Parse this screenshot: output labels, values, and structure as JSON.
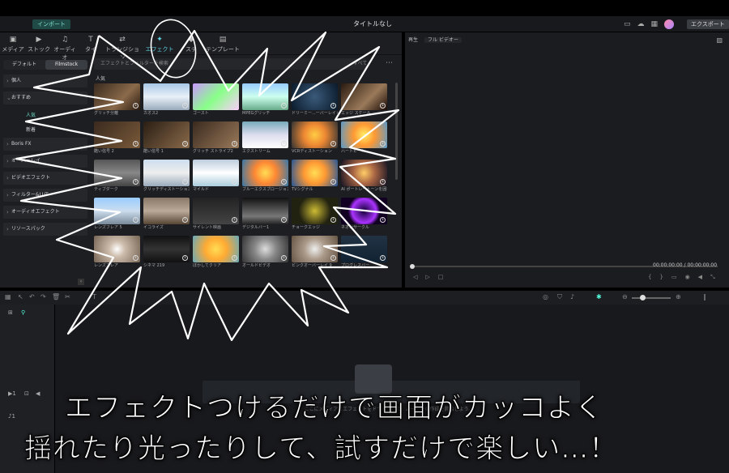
{
  "titlebar": {
    "import_label": "インポート",
    "title": "タイトルなし",
    "export_label": "エクスポート"
  },
  "toolbar": [
    {
      "label": "メディア",
      "icon": "image-icon",
      "active": false
    },
    {
      "label": "ストック",
      "icon": "stock-icon",
      "active": false
    },
    {
      "label": "オーディオ",
      "icon": "music-icon",
      "active": false
    },
    {
      "label": "タイ",
      "icon": "text-icon",
      "active": false
    },
    {
      "label": "トランジション",
      "icon": "transition-icon",
      "active": false
    },
    {
      "label": "エフェクト",
      "icon": "sparkle-icon",
      "active": true
    },
    {
      "label": "ステ",
      "icon": "sticker-icon",
      "active": false
    },
    {
      "label": "テンプレート",
      "icon": "template-icon",
      "active": false
    }
  ],
  "sidebar": {
    "tabs": [
      "デフォルト",
      "Filmstock"
    ],
    "active_tab": "Filmstock",
    "categories": [
      "個人",
      "おすすめ",
      "Boris FX",
      "オーバーレイ",
      "ビデオエフェクト",
      "フィルター&LUT",
      "オーディオエフェクト"
    ],
    "sub_items": [
      "人気",
      "新着"
    ],
    "resource_pack": "リソースパック"
  },
  "content": {
    "search_placeholder": "エフェクトとフィルターを検索",
    "sort_label": "すべて",
    "section": "人気"
  },
  "effects": [
    {
      "name": "グリッチ分離",
      "bg": "linear-gradient(135deg,#3a2a1e,#8a6a4a 60%,#2a1a10)"
    },
    {
      "name": "カオス2",
      "bg": "linear-gradient(180deg,#a8c8e8,#e8f0f8 50%,#9ab)"
    },
    {
      "name": "ゴースト",
      "bg": "linear-gradient(135deg,#c9f,#8f8 50%,#fcf)"
    },
    {
      "name": "MPEGグリッチ",
      "bg": "linear-gradient(180deg,#9cf,#cfe 50%,#6a8)"
    },
    {
      "name": "ドリーミー...ーバーレイ 04",
      "bg": "radial-gradient(circle,#3a5a7a,#0a1a2a)"
    },
    {
      "name": "エッジ スケール",
      "bg": "linear-gradient(135deg,#2a1a10,#9a7a5a 60%,#1a0a05)"
    },
    {
      "name": "酷い信号 2",
      "bg": "linear-gradient(135deg,#3a2a1e,#7a5a3a)"
    },
    {
      "name": "酷い信号 1",
      "bg": "linear-gradient(135deg,#2a1e14,#8a6a4a)"
    },
    {
      "name": "グリッチ ストライプ2",
      "bg": "linear-gradient(135deg,#3a2a1e,#9a7a5a)"
    },
    {
      "name": "エクストリーム",
      "bg": "linear-gradient(180deg,#7ab,#dde 50%,#fff)"
    },
    {
      "name": "VCRディストーション",
      "bg": "radial-gradient(circle,#fc4,#e83 40%,#333)"
    },
    {
      "name": "ハートビート",
      "bg": "radial-gradient(circle,#fe6,#f93 40%,#59c)"
    },
    {
      "name": "ティブダーク",
      "bg": "linear-gradient(180deg,#555,#888 50%,#444)"
    },
    {
      "name": "グリッチディストーション",
      "bg": "linear-gradient(180deg,#cde,#eee 50%,#9ab)"
    },
    {
      "name": "マイルド",
      "bg": "linear-gradient(180deg,#bcd,#fff 50%,#acd)"
    },
    {
      "name": "ブルーエクスプロージョン",
      "bg": "radial-gradient(circle,#fd5,#f83 40%,#37a)"
    },
    {
      "name": "TVシグナル",
      "bg": "radial-gradient(circle,#fd5,#f93 40%,#259)"
    },
    {
      "name": "AI ポートレートーンを囲む",
      "bg": "radial-gradient(circle,#fc6,#a64 40%,#112)"
    },
    {
      "name": "レンズフレア 5",
      "bg": "linear-gradient(180deg,#9cf,#cde 50%,#789)"
    },
    {
      "name": "イコライズ",
      "bg": "linear-gradient(180deg,#876,#ba9 50%,#543)"
    },
    {
      "name": "サイレント映画",
      "bg": "linear-gradient(180deg,#222,#444)"
    },
    {
      "name": "デジタルバー1",
      "bg": "linear-gradient(180deg,#111,#777 70%,#222)"
    },
    {
      "name": "チョークエッジ",
      "bg": "radial-gradient(circle,#cb3,#221 60%)"
    },
    {
      "name": "ネオンサークル",
      "bg": "radial-gradient(circle,#103,#a3f 45%,#102 60%)"
    },
    {
      "name": "レンズフレア",
      "bg": "radial-gradient(circle,#fff,#cba 30%,#765)"
    },
    {
      "name": "シネマ 219",
      "bg": "linear-gradient(180deg,#111,#333 50%,#111)"
    },
    {
      "name": "ぼかしてクリア",
      "bg": "radial-gradient(circle,#fd5,#fa3 40%,#6ab)"
    },
    {
      "name": "オールドビデオ",
      "bg": "radial-gradient(circle,#ddd,#888 40%,#333)"
    },
    {
      "name": "ピンクオーバーレイ 9",
      "bg": "radial-gradient(circle,#eee,#a98 40%,#654)"
    },
    {
      "name": "プログレスバー",
      "bg": "linear-gradient(180deg,#234,#123)"
    }
  ],
  "preview": {
    "label": "再生",
    "quality": "フル ビデオー",
    "time_current": "00:00:00:00",
    "time_total": "/ 00:00:00:00"
  },
  "timeline": {
    "drop_text": "ここにメディアとエフェクトをドラッグして、ムービーの作成を開始しよう。"
  },
  "captions": [
    "エフェクトつけるだけで画面がカッコよく",
    "揺れたり光ったりして、試すだけで楽しい…！"
  ]
}
